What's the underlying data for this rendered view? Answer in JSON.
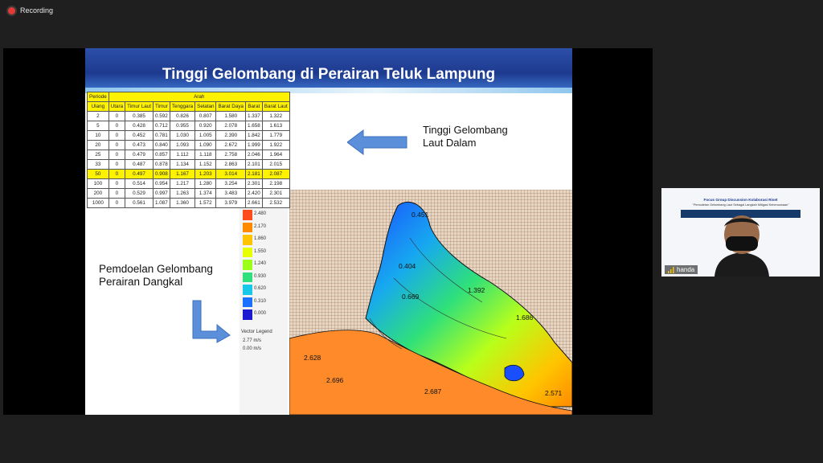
{
  "recording": {
    "label": "Recording"
  },
  "slide": {
    "title": "Tinggi Gelombang di Perairan Teluk Lampung",
    "table": {
      "header_periode": "Periode",
      "header_ulang": "Ulang",
      "header_arah": "Arah",
      "directions": [
        "Utara",
        "Timur Laut",
        "Timur",
        "Tenggara",
        "Selatan",
        "Barat Daya",
        "Barat",
        "Barat Laut"
      ],
      "rows": [
        [
          "2",
          "0",
          "0.385",
          "0.592",
          "0.826",
          "0.807",
          "1.580",
          "1.337",
          "1.322"
        ],
        [
          "5",
          "0",
          "0.428",
          "0.712",
          "0.955",
          "0.920",
          "2.078",
          "1.658",
          "1.613"
        ],
        [
          "10",
          "0",
          "0.452",
          "0.781",
          "1.030",
          "1.005",
          "2.390",
          "1.842",
          "1.779"
        ],
        [
          "20",
          "0",
          "0.473",
          "0.840",
          "1.093",
          "1.090",
          "2.672",
          "1.999",
          "1.922"
        ],
        [
          "25",
          "0",
          "0.479",
          "0.857",
          "1.112",
          "1.118",
          "2.758",
          "2.046",
          "1.964"
        ],
        [
          "33",
          "0",
          "0.487",
          "0.878",
          "1.134",
          "1.152",
          "2.863",
          "2.101",
          "2.015"
        ],
        [
          "50",
          "0",
          "0.497",
          "0.908",
          "1.167",
          "1.203",
          "3.014",
          "2.181",
          "2.087"
        ],
        [
          "100",
          "0",
          "0.514",
          "0.954",
          "1.217",
          "1.280",
          "3.254",
          "2.301",
          "2.198"
        ],
        [
          "200",
          "0",
          "0.529",
          "0.997",
          "1.263",
          "1.374",
          "3.483",
          "2.420",
          "2.301"
        ],
        [
          "1000",
          "0",
          "0.561",
          "1.087",
          "1.360",
          "1.572",
          "3.979",
          "2.661",
          "2.532"
        ]
      ],
      "highlight_row": 6
    },
    "deep_label": [
      "Tinggi Gelombang",
      "Laut Dalam"
    ],
    "shallow_label": [
      "Pemdoelan Gelombang",
      "Perairan Dangkal"
    ],
    "legend": {
      "levels": [
        "3.100",
        "2.790",
        "2.480",
        "2.170",
        "1.860",
        "1.550",
        "1.240",
        "0.930",
        "0.620",
        "0.310",
        "0.000"
      ],
      "colors": [
        "#b00000",
        "#d81a1a",
        "#ff4a1a",
        "#ff8a00",
        "#ffc400",
        "#e8ff00",
        "#9cff1a",
        "#2fe07a",
        "#17c8e8",
        "#1a70ff",
        "#1a1ad0"
      ],
      "vector_legend": "Vector Legend",
      "vec1": "2.77 m/s",
      "vec2": "0.00 m/s"
    },
    "map_labels": [
      "0.451",
      "0.404",
      "0.669",
      "1.392",
      "1.686",
      "2.628",
      "2.696",
      "2.687",
      "2.571"
    ]
  },
  "participant": {
    "name": "handa",
    "slide_title": "Focus Group Discussion Kolaborasi Riset",
    "slide_subtitle": "\"Pemodelan Gelombang Laut Sebagai Langkah Mitigasi Kebencanaan\""
  },
  "colors": {
    "accent_rec": "#e53935",
    "table_highlight": "#fff200",
    "title_blue": "#1d3a8f"
  }
}
